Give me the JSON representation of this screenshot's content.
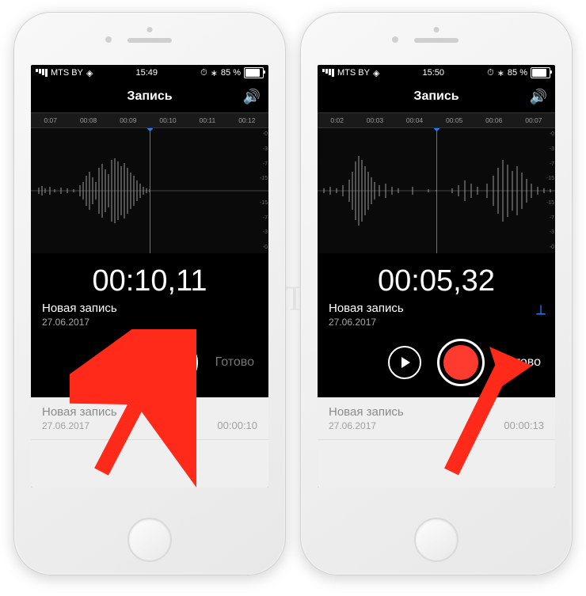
{
  "left": {
    "status": {
      "carrier": "MTS BY",
      "time": "15:49",
      "battery_pct": "85 %",
      "battery_fill": 85
    },
    "header_title": "Запись",
    "timeline_marks": [
      "0:07",
      "00:08",
      "00:09",
      "00:10",
      "00:11",
      "00:12"
    ],
    "db_marks": [
      "-0",
      "-3",
      "-7",
      "-15",
      "",
      "-15",
      "-7",
      "-3",
      "-0"
    ],
    "playhead_pct": 50,
    "timer": "00:10,11",
    "rec_title": "Новая запись",
    "rec_date": "27.06.2017",
    "done_label": "Готово",
    "list": {
      "title": "Новая запись",
      "date": "27.06.2017",
      "dur": "00:00:10"
    }
  },
  "right": {
    "status": {
      "carrier": "MTS BY",
      "time": "15:50",
      "battery_pct": "85 %",
      "battery_fill": 85
    },
    "header_title": "Запись",
    "timeline_marks": [
      "0:02",
      "00:03",
      "00:04",
      "00:05",
      "00:06",
      "00:07"
    ],
    "db_marks": [
      "-0",
      "-3",
      "-7",
      "-15",
      "",
      "-15",
      "-7",
      "-3",
      "-0"
    ],
    "playhead_pct": 50,
    "timer": "00:05,32",
    "rec_title": "Новая запись",
    "rec_date": "27.06.2017",
    "done_label": "Готово",
    "list": {
      "title": "Новая запись",
      "date": "27.06.2017",
      "dur": "00:00:13"
    }
  },
  "watermark": "ЯБЛЫК"
}
